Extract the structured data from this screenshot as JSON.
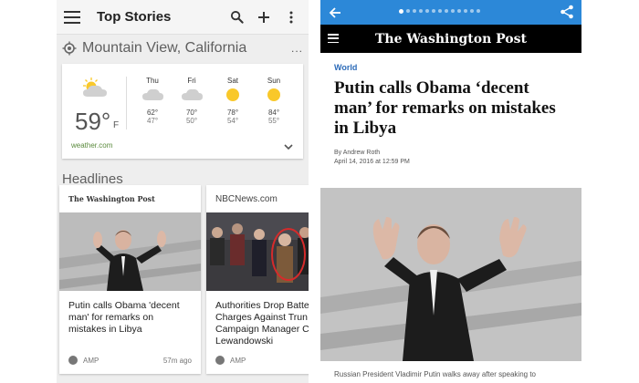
{
  "left_app": {
    "title": "Top Stories",
    "location": "Mountain View, California",
    "weather": {
      "current_temp": "59°",
      "unit": "F",
      "forecast": [
        {
          "day": "Thu",
          "icon": "cloudy-icon",
          "hi": "62°",
          "lo": "47°"
        },
        {
          "day": "Fri",
          "icon": "cloudy-icon",
          "hi": "70°",
          "lo": "50°"
        },
        {
          "day": "Sat",
          "icon": "sunny-icon",
          "hi": "78°",
          "lo": "54°"
        },
        {
          "day": "Sun",
          "icon": "sunny-icon",
          "hi": "84°",
          "lo": "55°"
        }
      ],
      "source": "weather.com"
    },
    "section_title": "Headlines",
    "cards": [
      {
        "publisher": "The Washington Post",
        "headline": "Putin calls Obama 'decent man' for remarks on mistakes in Libya",
        "badge": "AMP",
        "time": "57m ago"
      },
      {
        "publisher": "NBCNews.com",
        "headline": "Authorities Drop Batte Charges Against Trun Campaign Manager C Lewandowski",
        "badge": "AMP",
        "time": ""
      }
    ]
  },
  "right_app": {
    "masthead": "The Washington Post",
    "pager": {
      "count": 13,
      "active_index": 0
    },
    "section": "World",
    "headline": "Putin calls Obama ‘decent man’ for remarks on mistakes in Libya",
    "byline": "By Andrew Roth",
    "date": "April 14, 2016 at 12:59 PM",
    "caption": "Russian President Vladimir Putin walks away after speaking to"
  },
  "colors": {
    "amp_bar": "#2c88d8",
    "wp_bar": "#000000",
    "section_link": "#2c6bb8",
    "weather_source": "#5a8a3c",
    "sun": "#f9c82a"
  }
}
